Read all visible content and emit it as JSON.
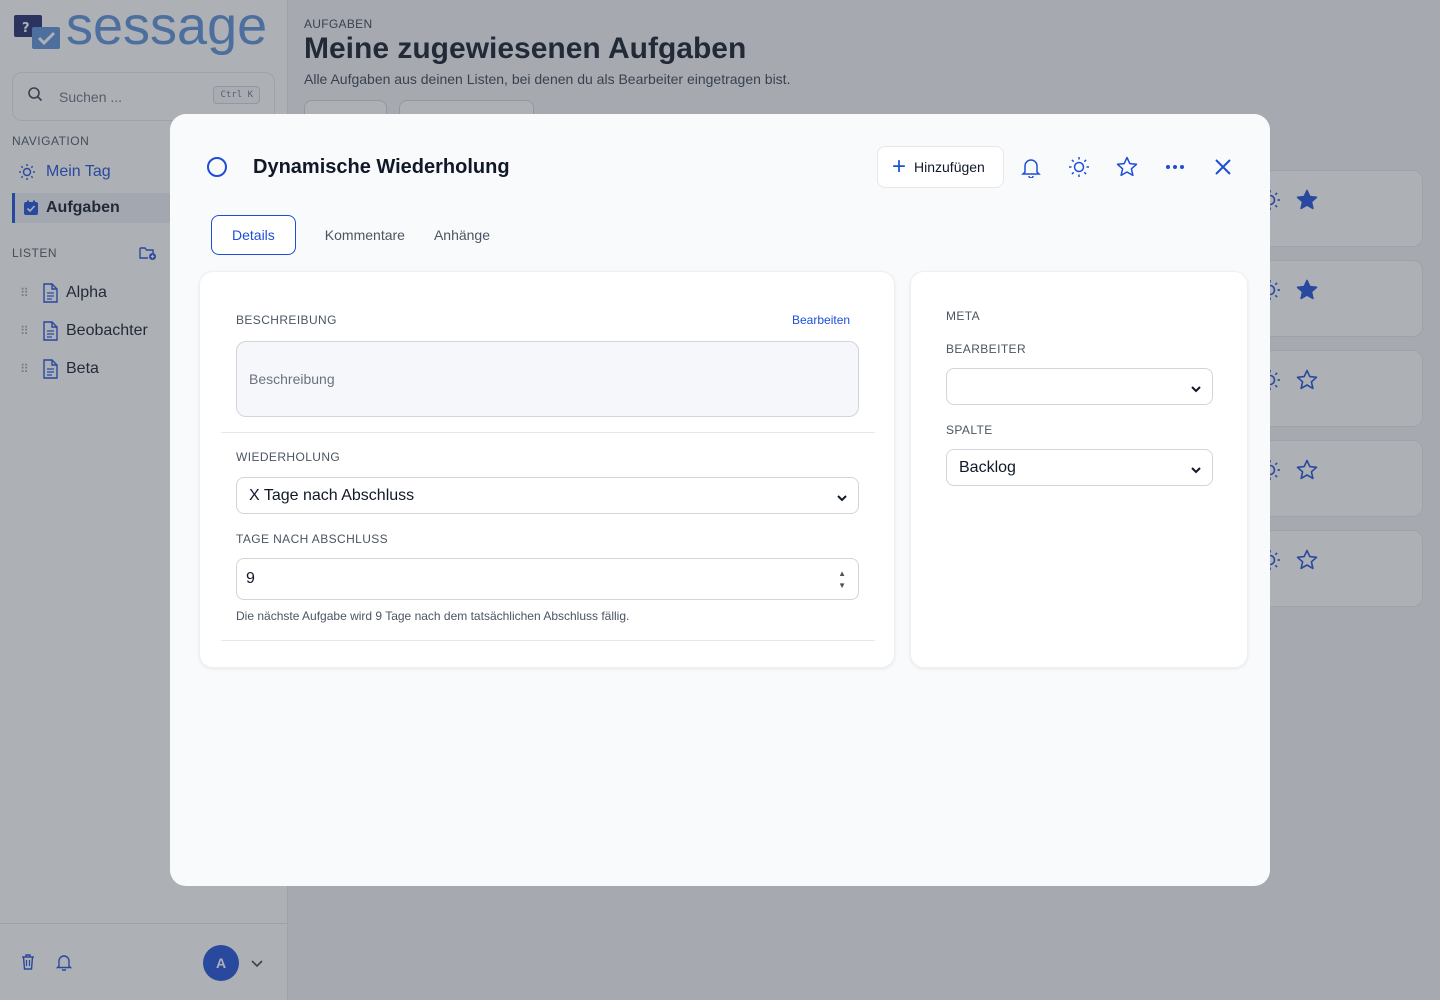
{
  "app": {
    "logo_text": "sessage"
  },
  "search": {
    "placeholder": "Suchen ...",
    "shortcut": "Ctrl K"
  },
  "sidebar": {
    "nav_heading": "NAVIGATION",
    "nav_items": [
      {
        "label": "Mein Tag",
        "icon": "sun-icon"
      },
      {
        "label": "Aufgaben",
        "icon": "tasks-icon",
        "active": true
      }
    ],
    "lists_heading": "LISTEN",
    "lists": [
      {
        "label": "Alpha",
        "icon": "document-icon"
      },
      {
        "label": "Beobachter",
        "icon": "document-icon"
      },
      {
        "label": "Beta",
        "icon": "document-icon"
      }
    ],
    "avatar_initial": "A"
  },
  "page": {
    "breadcrumb": "AUFGABEN",
    "title": "Meine zugewiesenen Aufgaben",
    "subtitle": "Alle Aufgaben aus deinen Listen, bei denen du als Bearbeiter eingetragen bist."
  },
  "task_cards": [
    {
      "starred": true
    },
    {
      "starred": true
    },
    {
      "starred": false
    },
    {
      "starred": false
    },
    {
      "starred": false
    }
  ],
  "modal": {
    "title": "Dynamische Wiederholung",
    "add_label": "Hinzufügen",
    "tabs": [
      "Details",
      "Kommentare",
      "Anhänge"
    ],
    "active_tab": "Details",
    "description": {
      "label": "BESCHREIBUNG",
      "edit_label": "Bearbeiten",
      "placeholder": "Beschreibung"
    },
    "recurrence": {
      "label": "WIEDERHOLUNG",
      "selected": "X Tage nach Abschluss"
    },
    "days_after": {
      "label": "TAGE NACH ABSCHLUSS",
      "value": "9",
      "hint": "Die nächste Aufgabe wird 9 Tage nach dem tatsächlichen Abschluss fällig."
    },
    "meta": {
      "heading": "META",
      "assignee_label": "BEARBEITER",
      "assignee_value": "",
      "column_label": "SPALTE",
      "column_value": "Backlog"
    }
  },
  "colors": {
    "accent": "#1d4ed8",
    "logo": "#5b8fd6",
    "overlay": "rgba(60,66,78,0.42)"
  }
}
